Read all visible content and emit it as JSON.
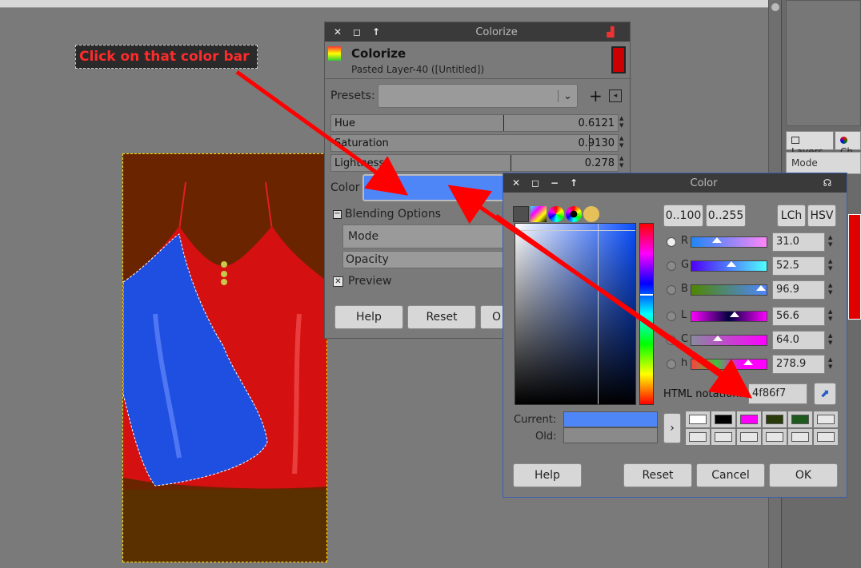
{
  "annotation": {
    "callout_text": "Click on that color bar"
  },
  "right_panel": {
    "tabs": [
      "Layers",
      "Ch"
    ],
    "mode_label": "Mode"
  },
  "colorize": {
    "window_title": "Colorize",
    "header_title": "Colorize",
    "header_subtitle": "Pasted Layer-40 ([Untitled])",
    "presets_label": "Presets:",
    "hue": {
      "label": "Hue",
      "value": "0.6121"
    },
    "saturation": {
      "label": "Saturation",
      "value": "0.9130"
    },
    "lightness": {
      "label": "Lightness",
      "value": "0.278"
    },
    "color_label": "Color",
    "color_value": "#4f86f7",
    "blending_label": "Blending Options",
    "mode_label": "Mode",
    "opacity_label": "Opacity",
    "preview_label": "Preview",
    "help_button": "Help",
    "reset_button": "Reset",
    "third_button": "O"
  },
  "color_dialog": {
    "window_title": "Color",
    "range_buttons": [
      "0..100",
      "0..255"
    ],
    "mode_buttons": [
      "LCh",
      "HSV"
    ],
    "channels": [
      {
        "label": "R",
        "value": "31.0",
        "fraction": 0.31
      },
      {
        "label": "G",
        "value": "52.5",
        "fraction": 0.525
      },
      {
        "label": "B",
        "value": "96.9",
        "fraction": 0.969
      },
      {
        "label": "L",
        "value": "56.6",
        "fraction": 0.566
      },
      {
        "label": "C",
        "value": "64.0",
        "fraction": 0.32
      },
      {
        "label": "h",
        "value": "278.9",
        "fraction": 0.775
      }
    ],
    "html_notation_label": "HTML notation:",
    "html_notation_value": "4f86f7",
    "current_label": "Current:",
    "old_label": "Old:",
    "current_color": "#4f86f7",
    "history_swatches": [
      "#ffffff",
      "#000000",
      "#ff00ff",
      "#2b3a0a",
      "#1e5a1e",
      "#e8e8e8"
    ],
    "help_button": "Help",
    "reset_button": "Reset",
    "cancel_button": "Cancel",
    "ok_button": "OK"
  },
  "colors": {
    "accent_red": "#ff0000",
    "selected_blue": "#4f86f7"
  }
}
